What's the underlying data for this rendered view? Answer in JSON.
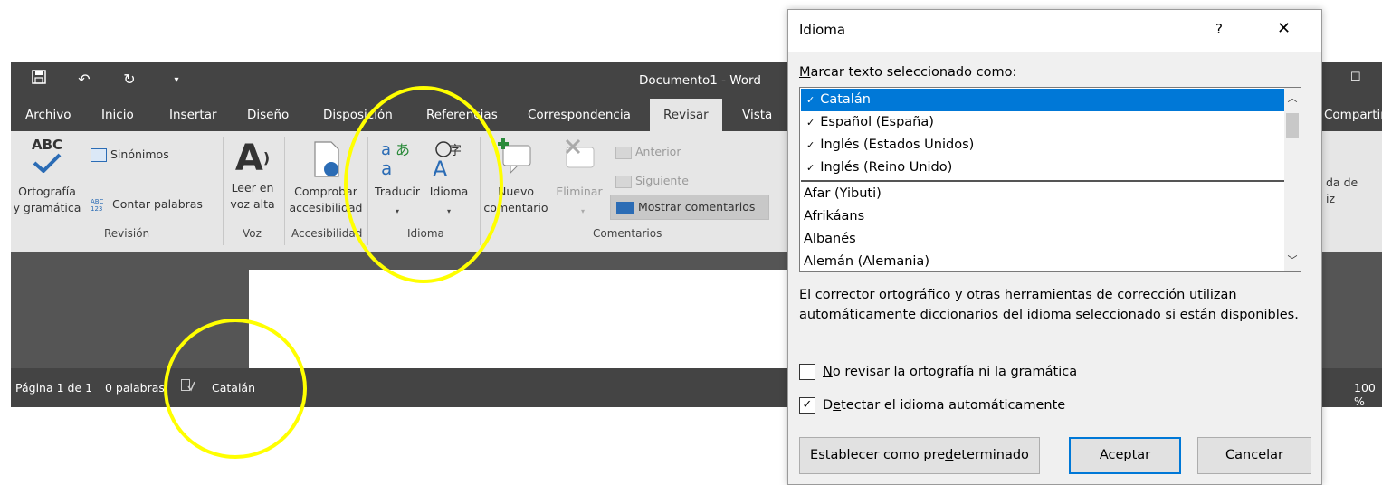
{
  "word": {
    "quick_access": [
      "save-icon",
      "undo-icon",
      "redo-icon",
      "customize-icon"
    ],
    "window_title": "Documento1  -  Word",
    "tabs": [
      {
        "label": "Archivo"
      },
      {
        "label": "Inicio"
      },
      {
        "label": "Insertar"
      },
      {
        "label": "Diseño"
      },
      {
        "label": "Disposición"
      },
      {
        "label": "Referencias"
      },
      {
        "label": "Correspondencia"
      },
      {
        "label": "Revisar"
      },
      {
        "label": "Vista"
      }
    ],
    "active_tab": "Revisar",
    "share_label": "Compartir",
    "ribbon": {
      "spelling": {
        "line1": "Ortografía",
        "line2": "y gramática",
        "icon_text": "ABC"
      },
      "thesaurus": "Sinónimos",
      "word_count": "Contar palabras",
      "word_count_icon": "ABC 123",
      "group_revision": "Revisión",
      "read_aloud": {
        "line1": "Leer en",
        "line2": "voz alta"
      },
      "group_voz": "Voz",
      "accessibility": {
        "line1": "Comprobar",
        "line2": "accesibilidad"
      },
      "group_accessibility": "Accesibilidad",
      "translate": "Traducir",
      "language": "Idioma",
      "group_language": "Idioma",
      "new_comment": {
        "line1": "Nuevo",
        "line2": "comentario"
      },
      "delete": "Eliminar",
      "previous": "Anterior",
      "next": "Siguiente",
      "show_comments": "Mostrar comentarios",
      "group_comments": "Comentarios",
      "partial_right": {
        "line1": "da de",
        "line2": "iz"
      }
    },
    "status": {
      "page": "Página 1 de 1",
      "words": "0 palabras",
      "language": "Catalán",
      "zoom": "100 %"
    }
  },
  "dialog": {
    "title": "Idioma",
    "help": "?",
    "close": "✕",
    "mark_label": "Marcar texto seleccionado como:",
    "languages": [
      {
        "name": "Catalán",
        "spell": true,
        "selected": true
      },
      {
        "name": "Español (España)",
        "spell": true
      },
      {
        "name": "Inglés (Estados Unidos)",
        "spell": true
      },
      {
        "name": "Inglés (Reino Unido)",
        "spell": true
      },
      {
        "name": "Afar (Yibuti)",
        "spell": false
      },
      {
        "name": "Afrikáans",
        "spell": false
      },
      {
        "name": "Albanés",
        "spell": false
      },
      {
        "name": "Alemán (Alemania)",
        "spell": false
      }
    ],
    "info": "El corrector ortográfico y otras herramientas de corrección utilizan automáticamente diccionarios del idioma seleccionado si están disponibles.",
    "no_check": {
      "label_pre": "",
      "label_u": "N",
      "label_post": "o revisar la ortografía ni la gramática",
      "checked": false
    },
    "detect": {
      "label_pre": "D",
      "label_u": "e",
      "label_post": "tectar el idioma automáticamente",
      "checked": true
    },
    "set_default": {
      "pre": "Establecer como pre",
      "u": "d",
      "post": "eterminado"
    },
    "accept": "Aceptar",
    "cancel": "Cancelar"
  },
  "colors": {
    "highlight": "#ffff00",
    "selection": "#0078d7",
    "titlebar": "#444444",
    "ribbon": "#e6e6e6"
  }
}
